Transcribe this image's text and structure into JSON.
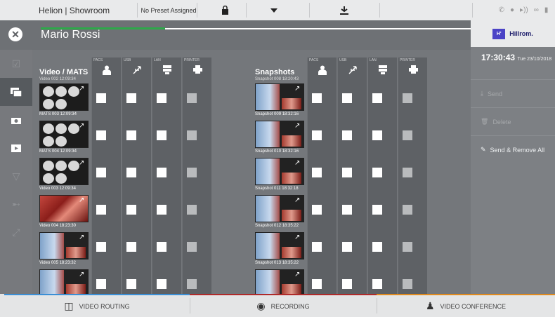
{
  "topbar": {
    "title": "Helion | Showroom",
    "preset": "No Preset Assigned",
    "lock_icon": "lock-icon",
    "dropdown_icon": "chevron-down-icon",
    "share_icon": "share-icon",
    "status_icons": [
      "phone-icon",
      "dot-icon",
      "wireless-icon",
      "glasses-icon",
      "bottle-icon"
    ]
  },
  "header": {
    "patient_name": "Mario Rossi",
    "progress_percent": 29
  },
  "leftnav": {
    "items": [
      {
        "name": "checklist",
        "icon": "clipboard-icon",
        "state": "dim"
      },
      {
        "name": "media-archive",
        "icon": "gallery-icon",
        "state": "active"
      },
      {
        "name": "camera",
        "icon": "camera-icon",
        "state": "normal"
      },
      {
        "name": "video",
        "icon": "film-icon",
        "state": "normal"
      },
      {
        "name": "filter",
        "icon": "funnel-icon",
        "state": "dim"
      },
      {
        "name": "pointer",
        "icon": "pointer-icon",
        "state": "dim"
      },
      {
        "name": "expand",
        "icon": "expand-icon",
        "state": "dim"
      }
    ]
  },
  "destinations": [
    {
      "label": "PACS",
      "icon": "doctor-icon"
    },
    {
      "label": "USB",
      "icon": "usb-icon"
    },
    {
      "label": "LAN",
      "icon": "server-icon"
    },
    {
      "label": "PRINTER",
      "icon": "printer-icon"
    }
  ],
  "videos": {
    "title": "Video / MATS",
    "top_caption": "Video 002 12:09:34",
    "items": [
      {
        "caption": "MATS 003 12:09:34",
        "kind": "vid"
      },
      {
        "caption": "MATS 004 12:09:34",
        "kind": "vid"
      },
      {
        "caption": "Video 003 12:09:34",
        "kind": "vid"
      },
      {
        "caption": "Video 004 18:23:30",
        "kind": "surg"
      },
      {
        "caption": "Video 005 18:23:32",
        "kind": "snap"
      },
      {
        "caption": "",
        "kind": "snap"
      }
    ]
  },
  "snapshots": {
    "title": "Snapshots",
    "top_caption": "Snapshot 008 18:20:43",
    "items": [
      {
        "caption": "Snapshot 009 18:32:16",
        "kind": "snap"
      },
      {
        "caption": "Snapshot 010 18:32:16",
        "kind": "snap"
      },
      {
        "caption": "Snapshot 011 18:32:18",
        "kind": "snap"
      },
      {
        "caption": "Snapshot 012 18:35:22",
        "kind": "snap"
      },
      {
        "caption": "Snapshot 013 18:35:22",
        "kind": "snap"
      },
      {
        "caption": "",
        "kind": "snap"
      }
    ]
  },
  "right_panel": {
    "brand": "Hillrom.",
    "brand_mark": "H'",
    "time": "17:30:43",
    "date": "Tue 23/10/2018",
    "actions": [
      {
        "label": "Send",
        "icon": "download-icon"
      },
      {
        "label": "Delete",
        "icon": "trash-icon"
      },
      {
        "label": "Send & Remove All",
        "icon": "user-edit-icon"
      }
    ]
  },
  "bottom": {
    "tabs": [
      {
        "label": "VIDEO ROUTING",
        "icon": "routing-icon",
        "color": "#3b8fd6"
      },
      {
        "label": "RECORDING",
        "icon": "recording-icon",
        "color": "#b02a2a"
      },
      {
        "label": "VIDEO CONFERENCE",
        "icon": "conference-icon",
        "color": "#e08a1e"
      }
    ]
  },
  "colors": {
    "progress": "#2ea84a",
    "brand_mark": "#4b43c6"
  }
}
